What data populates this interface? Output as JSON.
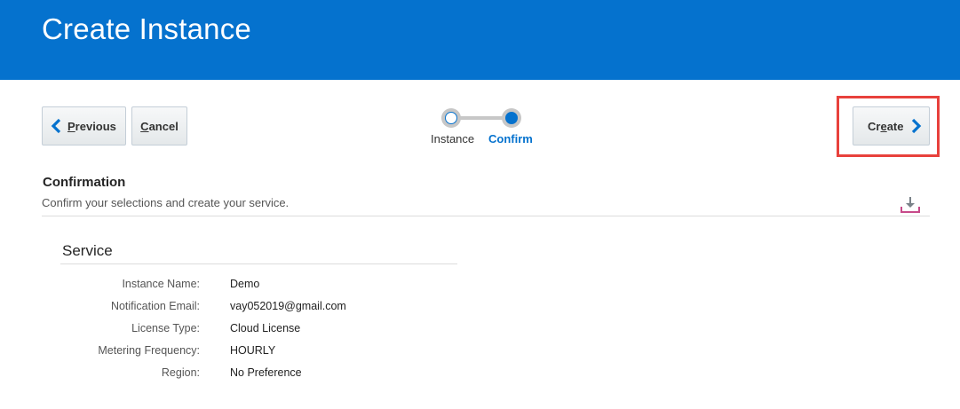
{
  "header": {
    "title": "Create Instance"
  },
  "toolbar": {
    "previous": {
      "pre": "",
      "ul": "P",
      "post": "revious"
    },
    "cancel": {
      "pre": "",
      "ul": "C",
      "post": "ancel"
    },
    "create": {
      "pre": "Cr",
      "ul": "e",
      "post": "ate"
    }
  },
  "train": {
    "steps": [
      {
        "label": "Instance",
        "state": "visited"
      },
      {
        "label": "Confirm",
        "state": "current"
      }
    ]
  },
  "confirmation": {
    "title": "Confirmation",
    "description": "Confirm your selections and create your service."
  },
  "service": {
    "title": "Service",
    "rows": [
      {
        "label": "Instance Name:",
        "value": "Demo"
      },
      {
        "label": "Notification Email:",
        "value": "vay052019@gmail.com"
      },
      {
        "label": "License Type:",
        "value": "Cloud License"
      },
      {
        "label": "Metering Frequency:",
        "value": "HOURLY"
      },
      {
        "label": "Region:",
        "value": "No Preference"
      }
    ]
  },
  "colors": {
    "brand": "#0572ce",
    "highlight": "#e8413c",
    "download_underline": "#c74a8a"
  },
  "icons": {
    "previous": "chevron-left-icon",
    "create": "chevron-right-icon",
    "download": "download-icon"
  }
}
